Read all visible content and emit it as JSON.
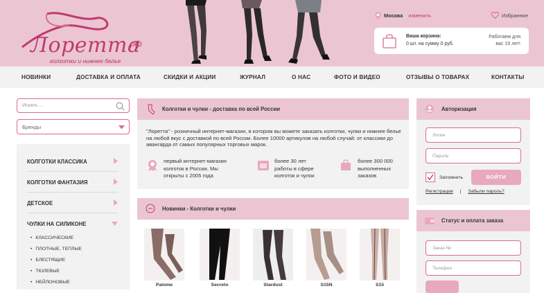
{
  "header": {
    "logo_text": "Лоретта",
    "logo_rf": "рф",
    "logo_sub": "колготки и нижнее белье",
    "city_label": "Москва",
    "city_change": "изменить",
    "favorites": "Избранное",
    "cart_title": "Ваша корзина:",
    "cart_sum": "0 шт. на сумму 0 руб.",
    "work_line1": "Работаем для",
    "work_line2": "вас 19 лет!"
  },
  "nav": {
    "items": [
      "НОВИНКИ",
      "ДОСТАВКА И ОПЛАТА",
      "СКИДКИ И АКЦИИ",
      "ЖУРНАЛ",
      "О НАС",
      "ФОТО И ВИДЕО",
      "ОТЗЫВЫ О ТОВАРАХ",
      "КОНТАКТЫ"
    ]
  },
  "sidebar": {
    "search_placeholder": "Искать ...",
    "brands": "Бренды",
    "categories": [
      "КОЛГОТКИ КЛАССИКА",
      "КОЛГОТКИ ФАНТАЗИЯ",
      "ДЕТСКОЕ",
      "ЧУЛКИ НА СИЛИКОНЕ"
    ],
    "subcategories": [
      "КЛАССИЧЕСКИЕ",
      "ПЛОТНЫЕ, ТЕПЛЫЕ",
      "БЛЕСТЯЩИЕ",
      "ТЮЛЕВЫЕ",
      "НЕЙЛОНОВЫЕ"
    ]
  },
  "main": {
    "panel1_title": "Колготки и чулки - доставка по всей России",
    "about_text": "\"Лоретта\" - розничный интернет-магазин, в котором вы можете заказать колготки, чулки и нижнее белье на любой вкус с доставкой по всей России. Более 10000 артикулов на любой случай: от классики до авангарда от самых популярных торговых марок.",
    "features": [
      {
        "l1": "первый интернет-магазин",
        "l2": "колготок в России. Мы",
        "l3": "открыты с 2005 года"
      },
      {
        "l1": "более 30 лет",
        "l2": "работы в сфере",
        "l3": "колготок и чулок"
      },
      {
        "l1": "более 300 000",
        "l2": "выполненных",
        "l3": "заказов"
      }
    ],
    "panel2_title": "Новинки - Колготки и чулки",
    "products": [
      "Palome",
      "Secreto",
      "Stardust",
      "S15N",
      "S15"
    ]
  },
  "right": {
    "auth_title": "Авторизация",
    "login_placeholder": "Логин",
    "password_placeholder": "Пароль",
    "remember": "Запомнить",
    "login_button": "ВОЙТИ",
    "register": "Регистрация",
    "separator": "|",
    "forgot": "Забыли пароль?",
    "status_title": "Статус и оплата заказа",
    "order_placeholder": "Заказ №",
    "phone_placeholder": "Телефон"
  },
  "colors": {
    "accent": "#c03a6e",
    "pink_bg": "#ebc6d2",
    "button": "#e8a8bd"
  }
}
